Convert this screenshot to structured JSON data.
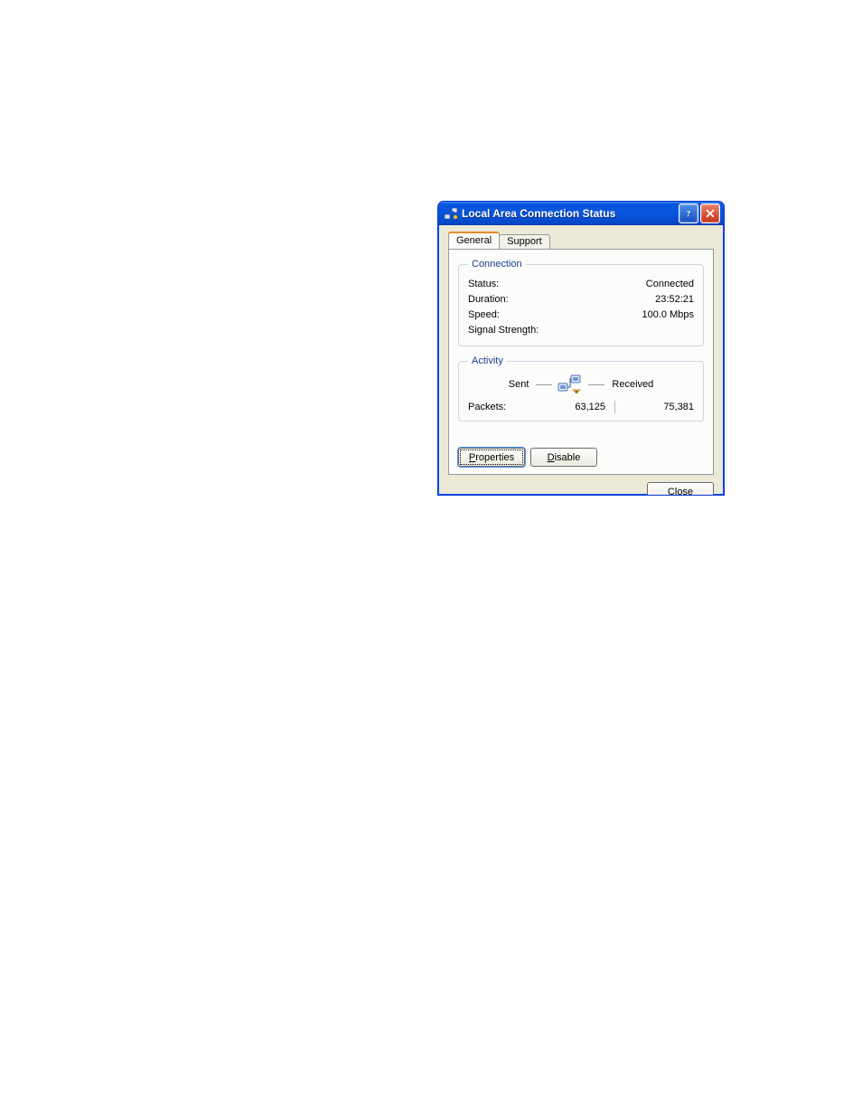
{
  "window": {
    "title": "Local Area Connection Status"
  },
  "tabs": {
    "general": "General",
    "support": "Support"
  },
  "connection": {
    "legend": "Connection",
    "status_label": "Status:",
    "status_value": "Connected",
    "duration_label": "Duration:",
    "duration_value": "23:52:21",
    "speed_label": "Speed:",
    "speed_value": "100.0 Mbps",
    "signal_label": "Signal Strength:",
    "signal_value": ""
  },
  "activity": {
    "legend": "Activity",
    "sent_label": "Sent",
    "received_label": "Received",
    "packets_label": "Packets:",
    "sent_value": "63,125",
    "received_value": "75,381"
  },
  "buttons": {
    "properties_prefix": "P",
    "properties_rest": "roperties",
    "disable_prefix": "D",
    "disable_rest": "isable",
    "close_prefix": "C",
    "close_rest": "lose"
  }
}
